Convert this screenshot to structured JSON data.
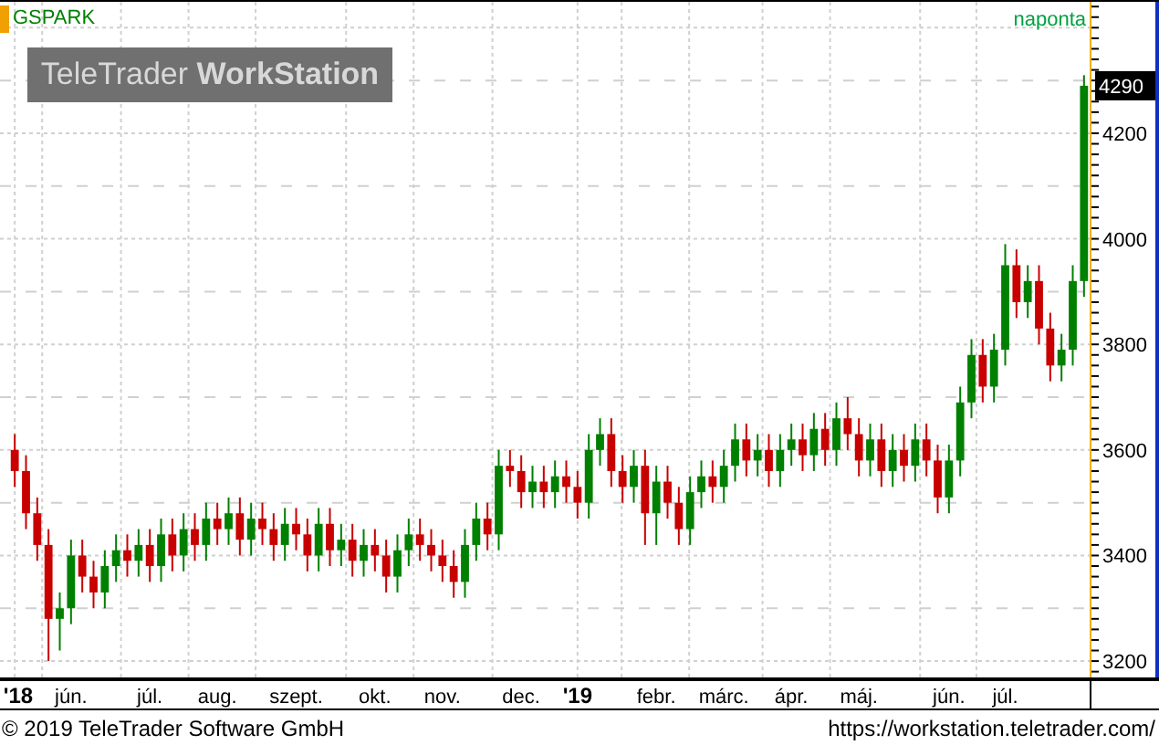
{
  "symbol": "GSPARK",
  "interval": "naponta",
  "logo": "TeleTrader **WorkStation**",
  "last_price": "4290",
  "chart": {
    "chart_data": {
      "type": "candlestick",
      "grid": true,
      "ylim": [
        3169,
        4449
      ],
      "yticks": [
        3200,
        3400,
        3600,
        3800,
        4000,
        4200
      ],
      "categories": [
        "**'18**",
        null,
        null,
        null,
        null,
        "jún.",
        null,
        null,
        null,
        null,
        null,
        null,
        "júl.",
        null,
        null,
        null,
        null,
        null,
        "aug.",
        null,
        null,
        null,
        null,
        null,
        null,
        "szept.",
        null,
        null,
        null,
        null,
        null,
        null,
        "okt.",
        null,
        null,
        null,
        null,
        null,
        "nov.",
        null,
        null,
        null,
        null,
        null,
        null,
        "dec.",
        null,
        null,
        null,
        null,
        "**'19**",
        null,
        null,
        null,
        null,
        null,
        null,
        "febr.",
        null,
        null,
        null,
        null,
        null,
        "márc.",
        null,
        null,
        null,
        null,
        null,
        "ápr.",
        null,
        null,
        null,
        null,
        null,
        "máj.",
        null,
        null,
        null,
        null,
        null,
        null,
        null,
        "jún.",
        null,
        null,
        null,
        null,
        "júl.",
        null,
        null,
        null,
        null,
        null,
        null,
        null
      ],
      "ohlc": [
        [
          3600,
          3630,
          3530,
          3560
        ],
        [
          3560,
          3590,
          3450,
          3480
        ],
        [
          3480,
          3510,
          3390,
          3420
        ],
        [
          3420,
          3450,
          3200,
          3280
        ],
        [
          3280,
          3330,
          3220,
          3300
        ],
        [
          3300,
          3430,
          3270,
          3400
        ],
        [
          3400,
          3430,
          3330,
          3360
        ],
        [
          3360,
          3390,
          3300,
          3330
        ],
        [
          3330,
          3410,
          3300,
          3380
        ],
        [
          3380,
          3440,
          3350,
          3410
        ],
        [
          3410,
          3440,
          3360,
          3390
        ],
        [
          3390,
          3450,
          3360,
          3420
        ],
        [
          3420,
          3450,
          3350,
          3380
        ],
        [
          3380,
          3470,
          3350,
          3440
        ],
        [
          3440,
          3470,
          3370,
          3400
        ],
        [
          3400,
          3480,
          3370,
          3450
        ],
        [
          3450,
          3480,
          3390,
          3420
        ],
        [
          3420,
          3500,
          3390,
          3470
        ],
        [
          3470,
          3500,
          3420,
          3450
        ],
        [
          3450,
          3510,
          3420,
          3480
        ],
        [
          3480,
          3510,
          3400,
          3430
        ],
        [
          3430,
          3500,
          3400,
          3470
        ],
        [
          3470,
          3500,
          3420,
          3450
        ],
        [
          3450,
          3480,
          3390,
          3420
        ],
        [
          3420,
          3490,
          3390,
          3460
        ],
        [
          3460,
          3490,
          3410,
          3440
        ],
        [
          3440,
          3470,
          3370,
          3400
        ],
        [
          3400,
          3490,
          3370,
          3460
        ],
        [
          3460,
          3490,
          3380,
          3410
        ],
        [
          3410,
          3460,
          3380,
          3430
        ],
        [
          3430,
          3460,
          3360,
          3390
        ],
        [
          3390,
          3450,
          3360,
          3420
        ],
        [
          3420,
          3450,
          3370,
          3400
        ],
        [
          3400,
          3430,
          3330,
          3360
        ],
        [
          3360,
          3440,
          3330,
          3410
        ],
        [
          3410,
          3470,
          3380,
          3440
        ],
        [
          3440,
          3470,
          3390,
          3420
        ],
        [
          3420,
          3450,
          3370,
          3400
        ],
        [
          3400,
          3430,
          3350,
          3380
        ],
        [
          3380,
          3410,
          3320,
          3350
        ],
        [
          3350,
          3450,
          3320,
          3420
        ],
        [
          3420,
          3500,
          3390,
          3470
        ],
        [
          3470,
          3500,
          3410,
          3440
        ],
        [
          3440,
          3600,
          3410,
          3570
        ],
        [
          3570,
          3600,
          3530,
          3560
        ],
        [
          3560,
          3590,
          3490,
          3520
        ],
        [
          3520,
          3570,
          3490,
          3540
        ],
        [
          3540,
          3570,
          3490,
          3520
        ],
        [
          3520,
          3580,
          3490,
          3550
        ],
        [
          3550,
          3580,
          3500,
          3530
        ],
        [
          3530,
          3560,
          3470,
          3500
        ],
        [
          3500,
          3630,
          3470,
          3600
        ],
        [
          3600,
          3660,
          3570,
          3630
        ],
        [
          3630,
          3660,
          3530,
          3560
        ],
        [
          3560,
          3590,
          3500,
          3530
        ],
        [
          3530,
          3600,
          3500,
          3570
        ],
        [
          3570,
          3600,
          3420,
          3480
        ],
        [
          3480,
          3570,
          3420,
          3540
        ],
        [
          3540,
          3570,
          3470,
          3500
        ],
        [
          3500,
          3530,
          3420,
          3450
        ],
        [
          3450,
          3550,
          3420,
          3520
        ],
        [
          3520,
          3580,
          3490,
          3550
        ],
        [
          3550,
          3580,
          3500,
          3530
        ],
        [
          3530,
          3600,
          3500,
          3570
        ],
        [
          3570,
          3650,
          3540,
          3620
        ],
        [
          3620,
          3650,
          3550,
          3580
        ],
        [
          3580,
          3630,
          3550,
          3600
        ],
        [
          3600,
          3630,
          3530,
          3560
        ],
        [
          3560,
          3630,
          3530,
          3600
        ],
        [
          3600,
          3650,
          3570,
          3620
        ],
        [
          3620,
          3650,
          3560,
          3590
        ],
        [
          3590,
          3670,
          3560,
          3640
        ],
        [
          3640,
          3670,
          3570,
          3600
        ],
        [
          3600,
          3690,
          3570,
          3660
        ],
        [
          3660,
          3700,
          3600,
          3630
        ],
        [
          3630,
          3660,
          3550,
          3580
        ],
        [
          3580,
          3650,
          3550,
          3620
        ],
        [
          3620,
          3650,
          3530,
          3560
        ],
        [
          3560,
          3630,
          3530,
          3600
        ],
        [
          3600,
          3630,
          3540,
          3570
        ],
        [
          3570,
          3650,
          3540,
          3620
        ],
        [
          3620,
          3650,
          3550,
          3580
        ],
        [
          3580,
          3610,
          3480,
          3510
        ],
        [
          3510,
          3610,
          3480,
          3580
        ],
        [
          3580,
          3720,
          3550,
          3690
        ],
        [
          3690,
          3810,
          3660,
          3780
        ],
        [
          3780,
          3810,
          3690,
          3720
        ],
        [
          3720,
          3820,
          3690,
          3790
        ],
        [
          3790,
          3990,
          3760,
          3950
        ],
        [
          3950,
          3980,
          3850,
          3880
        ],
        [
          3880,
          3950,
          3850,
          3920
        ],
        [
          3920,
          3950,
          3800,
          3830
        ],
        [
          3830,
          3860,
          3730,
          3760
        ],
        [
          3760,
          3820,
          3730,
          3790
        ],
        [
          3790,
          3950,
          3760,
          3920
        ],
        [
          3920,
          4310,
          3890,
          4290
        ]
      ]
    }
  },
  "footer": {
    "copyright": "© 2019 TeleTrader Software GmbH",
    "url": "https://workstation.teletrader.com/"
  }
}
